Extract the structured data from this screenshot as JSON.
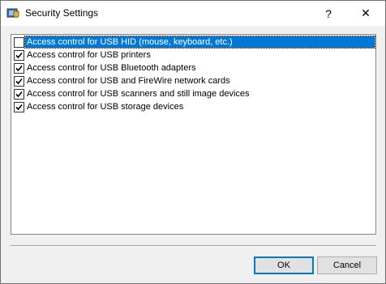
{
  "window": {
    "title": "Security Settings",
    "help_glyph": "?",
    "close_glyph": "✕",
    "icon": "security-settings-app-icon"
  },
  "list": {
    "items": [
      {
        "label": "Access control for USB HID (mouse, keyboard, etc.)",
        "checked": false,
        "selected": true
      },
      {
        "label": "Access control for USB printers",
        "checked": true,
        "selected": false
      },
      {
        "label": "Access control for USB Bluetooth adapters",
        "checked": true,
        "selected": false
      },
      {
        "label": "Access control for USB and FireWire network cards",
        "checked": true,
        "selected": false
      },
      {
        "label": "Access control for USB scanners and still image devices",
        "checked": true,
        "selected": false
      },
      {
        "label": "Access control for USB storage devices",
        "checked": true,
        "selected": false
      }
    ]
  },
  "buttons": {
    "ok_label": "OK",
    "cancel_label": "Cancel"
  },
  "colors": {
    "selection": "#0078d7",
    "default_button_border": "#0078d7"
  }
}
